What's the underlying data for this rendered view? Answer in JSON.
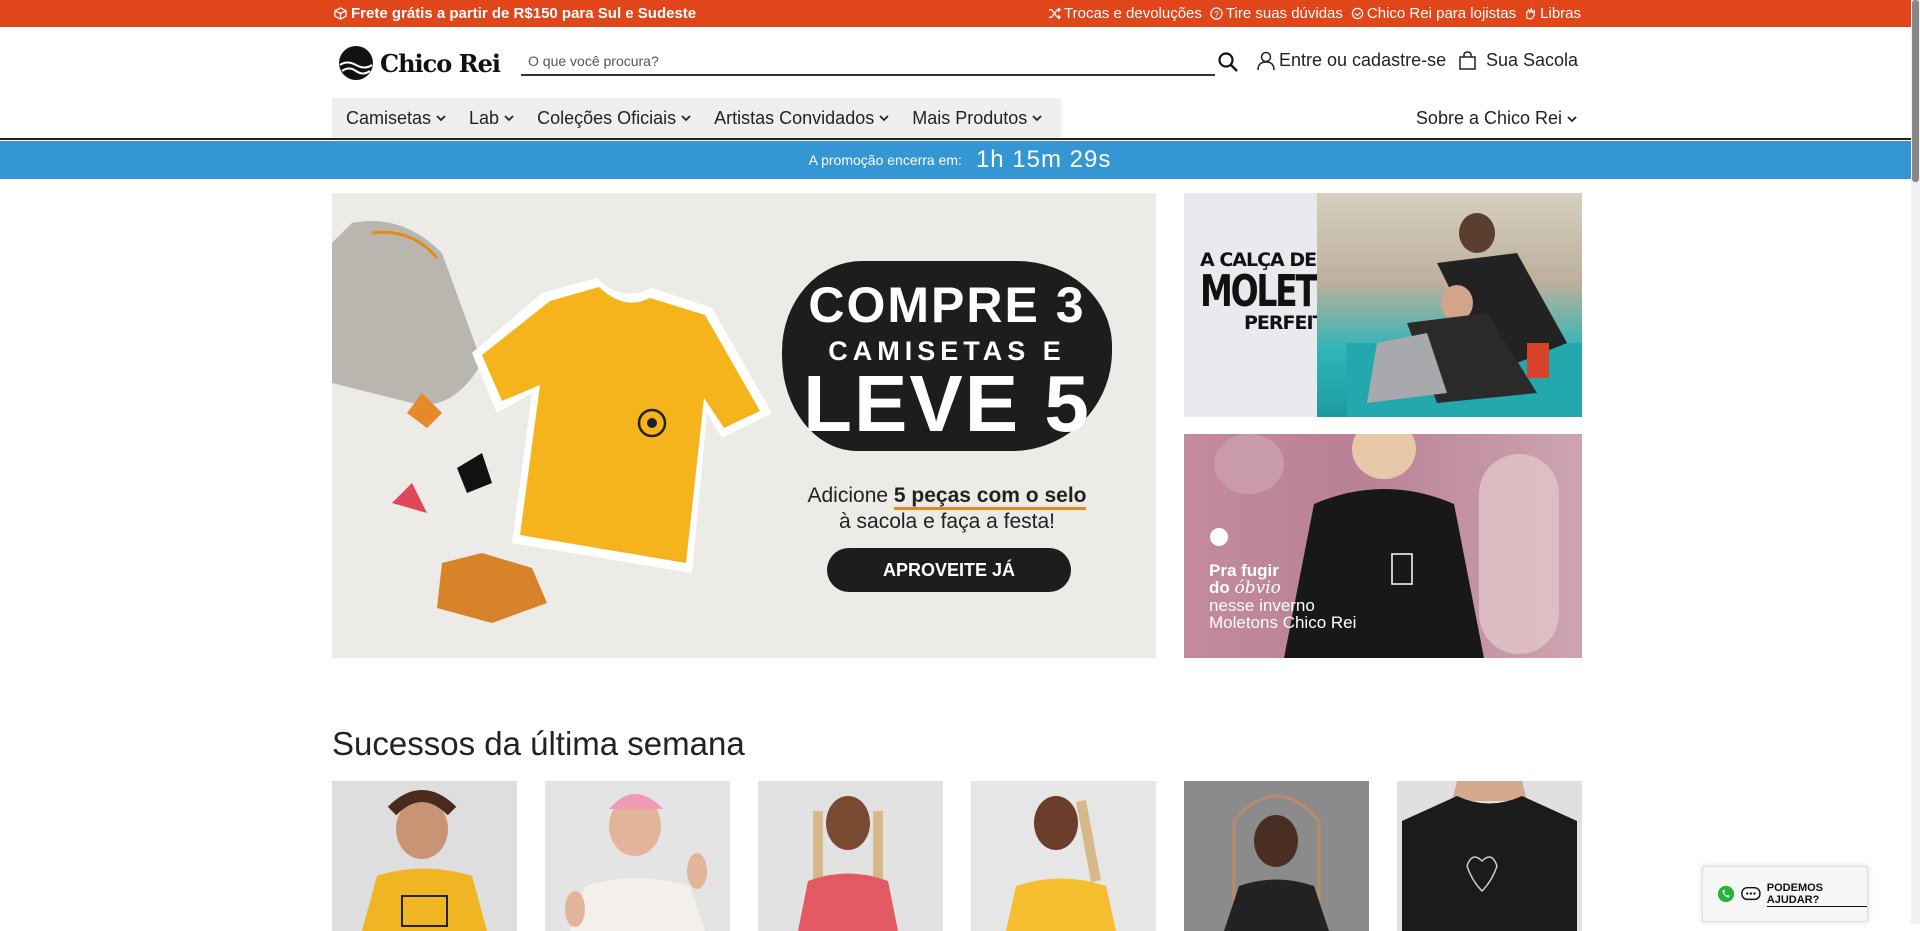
{
  "topbar": {
    "shipping": "Frete grátis a partir de R$150 para Sul e Sudeste",
    "links": [
      "Trocas e devoluções",
      "Tire suas dúvidas",
      "Chico Rei para lojistas",
      "Libras"
    ]
  },
  "header": {
    "logo_text": "Chico Rei",
    "search_placeholder": "O que você procura?",
    "login": "Entre ou cadastre-se",
    "bag": "Sua Sacola"
  },
  "nav": {
    "items": [
      "Camisetas",
      "Lab",
      "Coleções Oficiais",
      "Artistas Convidados",
      "Mais Produtos"
    ],
    "about": "Sobre a Chico Rei"
  },
  "promo": {
    "label": "A promoção encerra em:",
    "timer": "1h 15m 29s"
  },
  "hero": {
    "line1": "COMPRE 3",
    "line2": "CAMISETAS E",
    "line3": "LEVE 5",
    "sub_pre": "Adicione ",
    "sub_bold": "5 peças com o selo",
    "sub2": "à sacola e faça a festa!",
    "cta": "APROVEITE JÁ"
  },
  "side1": {
    "l1": "A CALÇA DE",
    "l2": "MOLETOM",
    "l3": "PERFEITA"
  },
  "side2": {
    "l1": "Pra fugir",
    "l2a": "do ",
    "l2b": "óbvio",
    "l3": "nesse inverno",
    "l4": "Moletons Chico Rei"
  },
  "section": {
    "title": "Sucessos da última semana"
  },
  "chat": {
    "label": "PODEMOS AJUDAR?"
  },
  "colors": {
    "topbar": "#e0461a",
    "promo": "#3496d2",
    "accent": "#e38a1c"
  }
}
